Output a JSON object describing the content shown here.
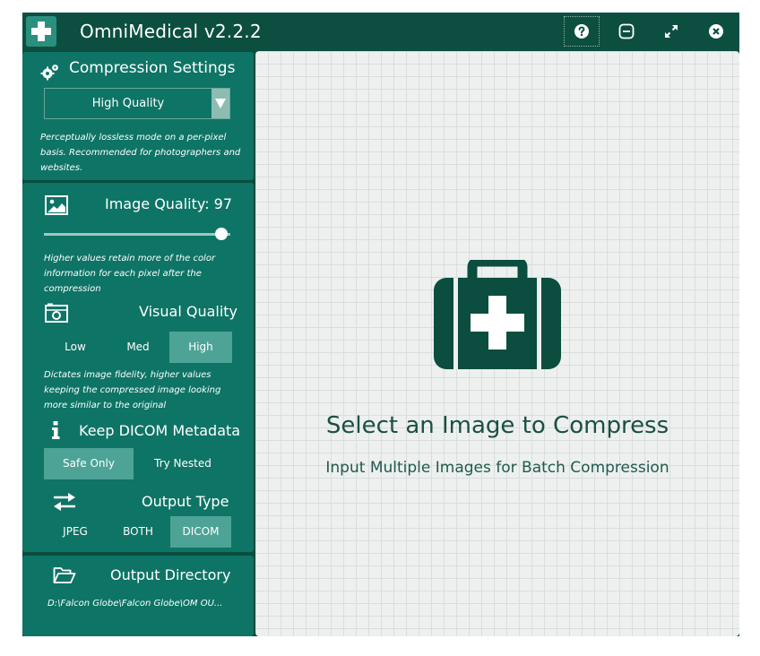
{
  "titlebar": {
    "title": "OmniMedical v2.2.2",
    "buttons": [
      "help-icon",
      "minimize-icon",
      "maximize-icon",
      "close-icon"
    ]
  },
  "compression": {
    "heading": "Compression Settings",
    "preset": "High Quality",
    "description": "Perceptually lossless mode on a per-pixel basis. Recommended for photographers and websites."
  },
  "image_quality": {
    "label": "Image Quality: 97",
    "value": 97,
    "note": "Higher values retain more of the color information for each pixel after the compression"
  },
  "visual_quality": {
    "heading": "Visual Quality",
    "options": [
      "Low",
      "Med",
      "High"
    ],
    "selected": "High",
    "note": "Dictates image fidelity, higher values keeping the compressed image looking more similar to the original"
  },
  "dicom_metadata": {
    "heading": "Keep DICOM Metadata",
    "options": [
      "Safe Only",
      "Try Nested"
    ],
    "selected": "Safe Only"
  },
  "output_type": {
    "heading": "Output Type",
    "options": [
      "JPEG",
      "BOTH",
      "DICOM"
    ],
    "selected": "DICOM"
  },
  "output_directory": {
    "heading": "Output Directory",
    "path": "D:\\Falcon Globe\\Falcon Globe\\OM OU..."
  },
  "main": {
    "title": "Select an Image to Compress",
    "subtitle": "Input Multiple Images for Batch Compression"
  },
  "colors": {
    "titlebar": "#0c4f40",
    "panel": "#0e7466",
    "selected_segment": "#4da396",
    "kit_icon": "#0b4d3f"
  }
}
